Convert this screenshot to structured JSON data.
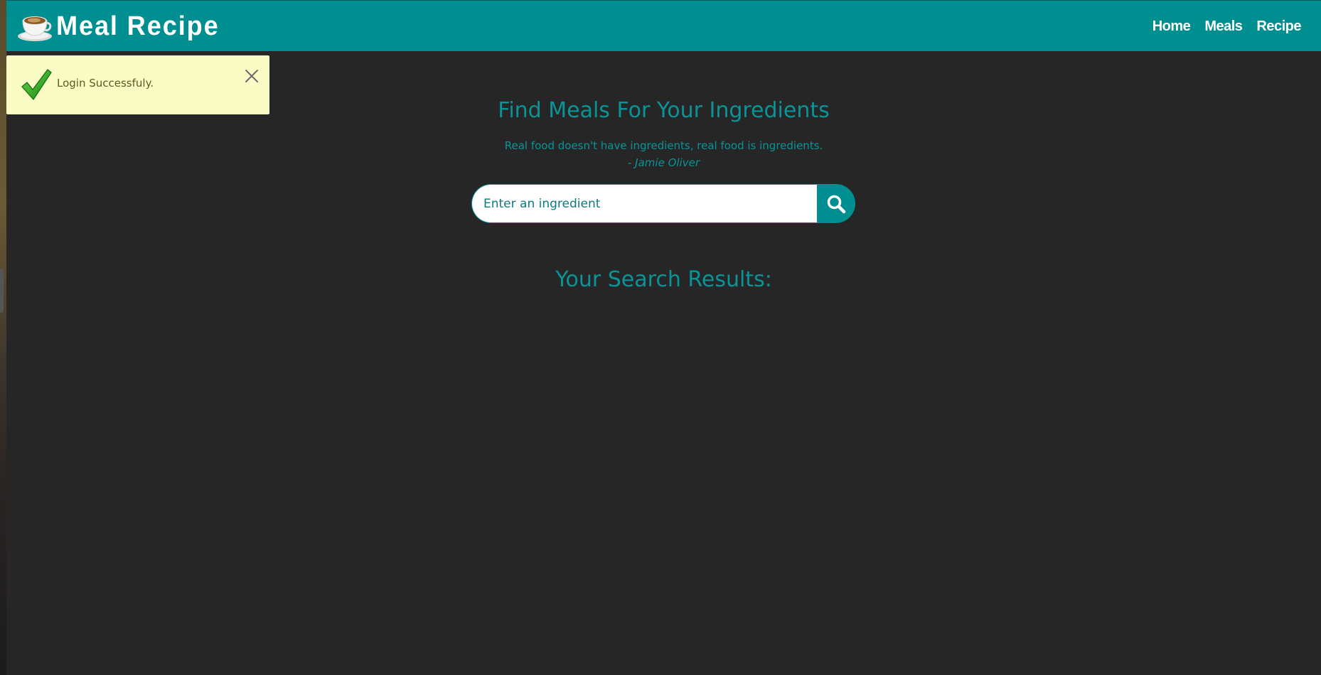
{
  "navbar": {
    "brand_title": "Meal Recipe",
    "brand_icon": "coffee-cup-icon",
    "links": [
      {
        "label": "Home"
      },
      {
        "label": "Meals"
      },
      {
        "label": "Recipe"
      }
    ]
  },
  "toast": {
    "icon": "check-icon",
    "message": "Login Successfuly.",
    "close_icon": "close-icon"
  },
  "main": {
    "title": "Find Meals For Your Ingredients",
    "quote": "Real food doesn't have ingredients, real food is ingredients.",
    "quote_author": "- Jamie Oliver",
    "search": {
      "placeholder": "Enter an ingredient",
      "value": "",
      "button_icon": "search-icon"
    },
    "results_title": "Your Search Results:"
  },
  "colors": {
    "accent": "#008f91",
    "background": "#262626",
    "toast_bg": "#fbfbc6",
    "text_accent": "#0a9497"
  }
}
